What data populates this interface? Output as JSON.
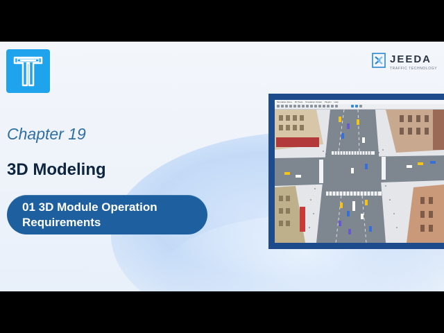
{
  "slide": {
    "chapter": "Chapter 19",
    "title": "3D Modeling",
    "subtitle": "01 3D Module Operation Requirements"
  },
  "brand": {
    "name": "JEEDA",
    "tagline": "TRAFFIC TECHNOLOGY"
  },
  "screenshot": {
    "menu_items": [
      "Simulation Runs",
      "3D Tools",
      "Simulation Output",
      "Plugins",
      "Help"
    ],
    "colors": {
      "frame": "#1d4b8c",
      "road": "#7e8690",
      "sidewalk": "#e4e6ea"
    }
  },
  "colors": {
    "accent": "#1ea3ec",
    "pill": "#1d5f9f",
    "chapter": "#2d6fa6",
    "title": "#0e2540"
  },
  "icons": {
    "logo": "tram-track-logo-icon",
    "brand_mark": "jeeda-logo-icon"
  }
}
